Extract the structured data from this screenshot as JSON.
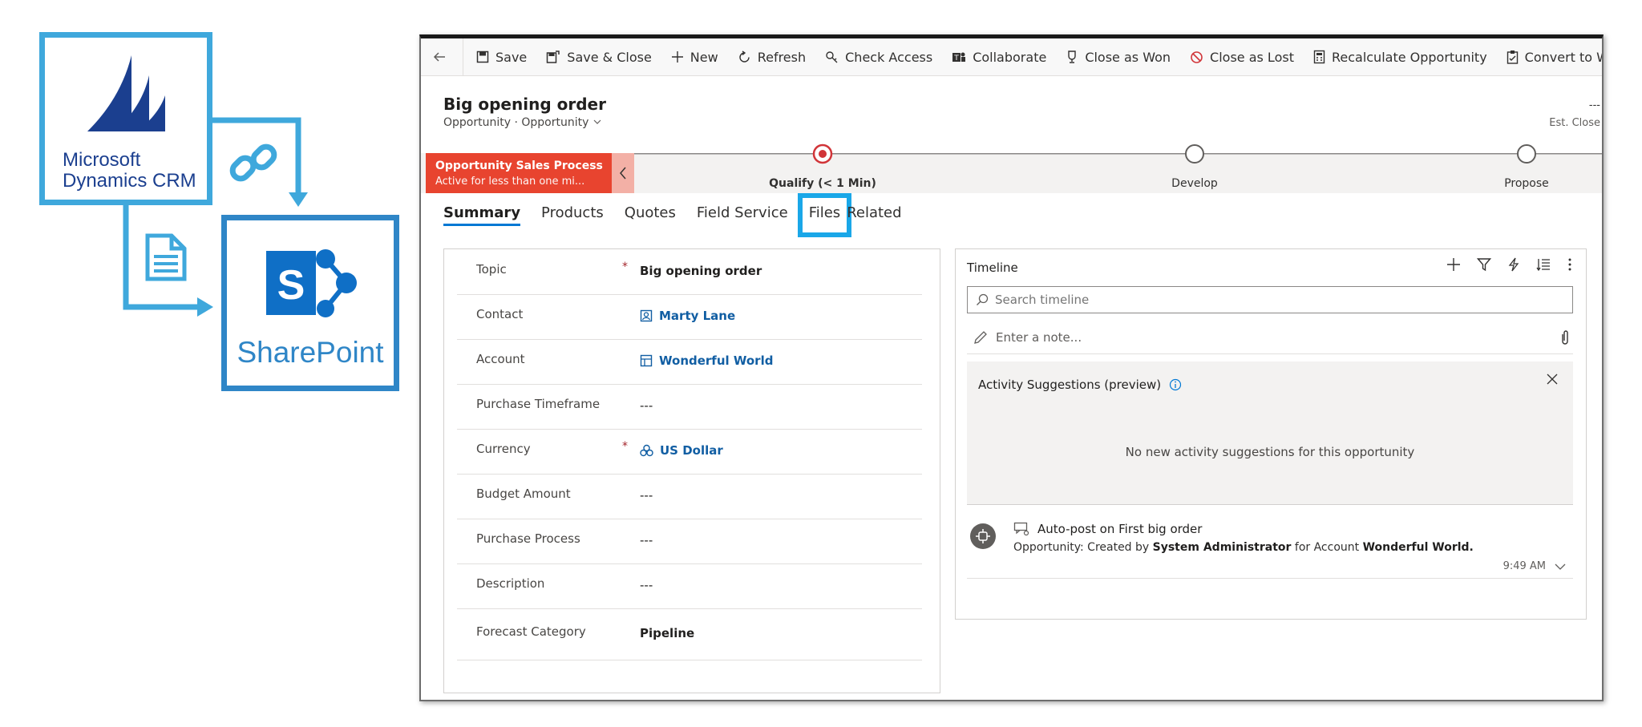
{
  "graphic": {
    "crm_label_line1": "Microsoft",
    "crm_label_line2": "Dynamics CRM",
    "sharepoint_label": "SharePoint",
    "colors": {
      "crm_border": "#3fa8dc",
      "sp_border": "#2f86c7",
      "crm_logo": "#1b3f8f",
      "sp_logo": "#0f6fc6"
    }
  },
  "toolbar": {
    "items": [
      {
        "label": "Save",
        "icon": "save-icon"
      },
      {
        "label": "Save & Close",
        "icon": "save-close-icon"
      },
      {
        "label": "New",
        "icon": "plus-icon"
      },
      {
        "label": "Refresh",
        "icon": "refresh-icon"
      },
      {
        "label": "Check Access",
        "icon": "key-icon"
      },
      {
        "label": "Collaborate",
        "icon": "teams-icon"
      },
      {
        "label": "Close as Won",
        "icon": "trophy-icon"
      },
      {
        "label": "Close as Lost",
        "icon": "block-icon"
      },
      {
        "label": "Recalculate Opportunity",
        "icon": "calculator-icon"
      },
      {
        "label": "Convert to Work Ord",
        "icon": "clipboard-icon"
      }
    ]
  },
  "record": {
    "title": "Big opening order",
    "entity": "Opportunity",
    "separator": "·",
    "form": "Opportunity",
    "right_value": "---",
    "right_label": "Est. Close"
  },
  "process": {
    "name": "Opportunity Sales Process",
    "status": "Active for less than one mi...",
    "stages": [
      {
        "label": "Qualify  (< 1 Min)",
        "active": true
      },
      {
        "label": "Develop",
        "active": false
      },
      {
        "label": "Propose",
        "active": false
      }
    ],
    "accent": "#e8442f"
  },
  "tabs": [
    "Summary",
    "Products",
    "Quotes",
    "Field Service",
    "Files",
    "Related"
  ],
  "fields": [
    {
      "label": "Topic",
      "required": "*",
      "value": "Big opening order",
      "style": "bold"
    },
    {
      "label": "Contact",
      "required": "",
      "value": "Marty Lane",
      "style": "link",
      "icon": "contact-icon"
    },
    {
      "label": "Account",
      "required": "",
      "value": "Wonderful World",
      "style": "link",
      "icon": "account-icon"
    },
    {
      "label": "Purchase Timeframe",
      "required": "",
      "value": "---",
      "style": "plain"
    },
    {
      "label": "Currency",
      "required": "*",
      "value": "US Dollar",
      "style": "link",
      "icon": "currency-icon"
    },
    {
      "label": "Budget Amount",
      "required": "",
      "value": "---",
      "style": "plain"
    },
    {
      "label": "Purchase Process",
      "required": "",
      "value": "---",
      "style": "plain"
    },
    {
      "label": "Description",
      "required": "",
      "value": "---",
      "style": "plain"
    },
    {
      "label": "Forecast Category",
      "required": "",
      "value": "Pipeline",
      "style": "bold"
    }
  ],
  "timeline": {
    "title": "Timeline",
    "search_placeholder": "Search timeline",
    "note_placeholder": "Enter a note...",
    "suggestions_title": "Activity Suggestions (preview)",
    "suggestions_empty": "No new activity suggestions for this opportunity",
    "post": {
      "title": "Auto-post on First big order",
      "prefix": "Opportunity: Created by ",
      "actor": "System Administrator",
      "middle": " for Account ",
      "target": "Wonderful World.",
      "time": "9:49 AM"
    }
  }
}
